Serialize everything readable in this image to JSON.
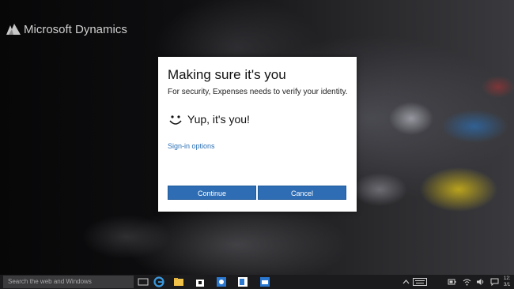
{
  "brand": {
    "name": "Microsoft Dynamics"
  },
  "dialog": {
    "title": "Making sure it's you",
    "subtitle": "For security, Expenses needs to verify your identity.",
    "status": "Yup, it's you!",
    "signin_link": "Sign-in options",
    "continue_label": "Continue",
    "cancel_label": "Cancel"
  },
  "taskbar": {
    "search_placeholder": "Search the web and Windows",
    "clock_time": "12:",
    "clock_date": "3/1"
  },
  "colors": {
    "accent": "#2e6db4",
    "link": "#2a6fb5",
    "dialog_bg": "#ffffff",
    "taskbar_bg": "#1b1b1d"
  },
  "icons": {
    "brand": "dynamics-logo-icon",
    "status": "smiley-face-icon",
    "taskbar": [
      "task-view-icon",
      "edge-browser-icon",
      "file-explorer-icon",
      "store-icon",
      "app-icon",
      "lync-icon",
      "photos-icon"
    ],
    "tray": [
      "chevron-up-icon",
      "keyboard-icon",
      "battery-icon",
      "wifi-icon",
      "volume-icon",
      "action-center-icon"
    ]
  }
}
